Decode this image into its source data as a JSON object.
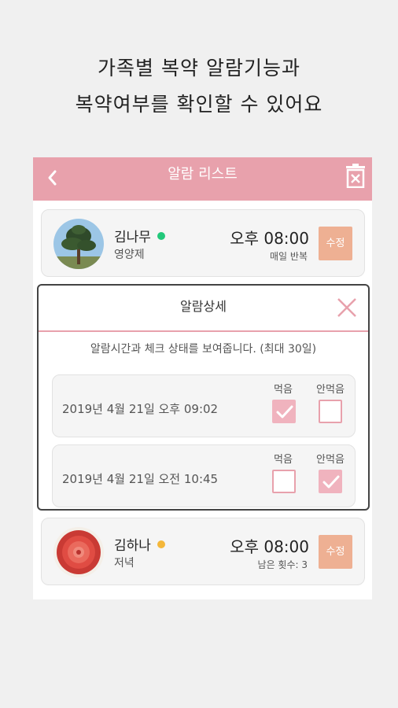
{
  "headline": {
    "line1": "가족별 복약 알람기능과",
    "line2": "복약여부를 확인할 수 있어요"
  },
  "appbar": {
    "title": "알람 리스트",
    "back_icon": "chevron-left-icon",
    "delete_icon": "trash-icon",
    "color": "#e8a1ac"
  },
  "alarms": [
    {
      "name": "김나무",
      "status_color": "#22c87a",
      "subtitle": "영양제",
      "time": "오후 08:00",
      "meta": "매일 반복",
      "edit_label": "수정"
    },
    {
      "name": "김하나",
      "status_color": "#f4b73a",
      "subtitle": "저녁",
      "time": "오후 08:00",
      "meta": "남은 횟수: 3",
      "edit_label": "수정"
    }
  ],
  "detail_modal": {
    "title": "알람상세",
    "close_icon": "close-icon",
    "description": "알람시간과 체크 상태를 보여줍니다. (최대 30일)",
    "records": [
      {
        "datetime": "2019년 4월 21일 오후 09:02",
        "taken_label": "먹음",
        "not_taken_label": "안먹음",
        "taken": true,
        "not_taken": false
      },
      {
        "datetime": "2019년 4월 21일 오전 10:45",
        "taken_label": "먹음",
        "not_taken_label": "안먹음",
        "taken": false,
        "not_taken": true
      }
    ]
  }
}
